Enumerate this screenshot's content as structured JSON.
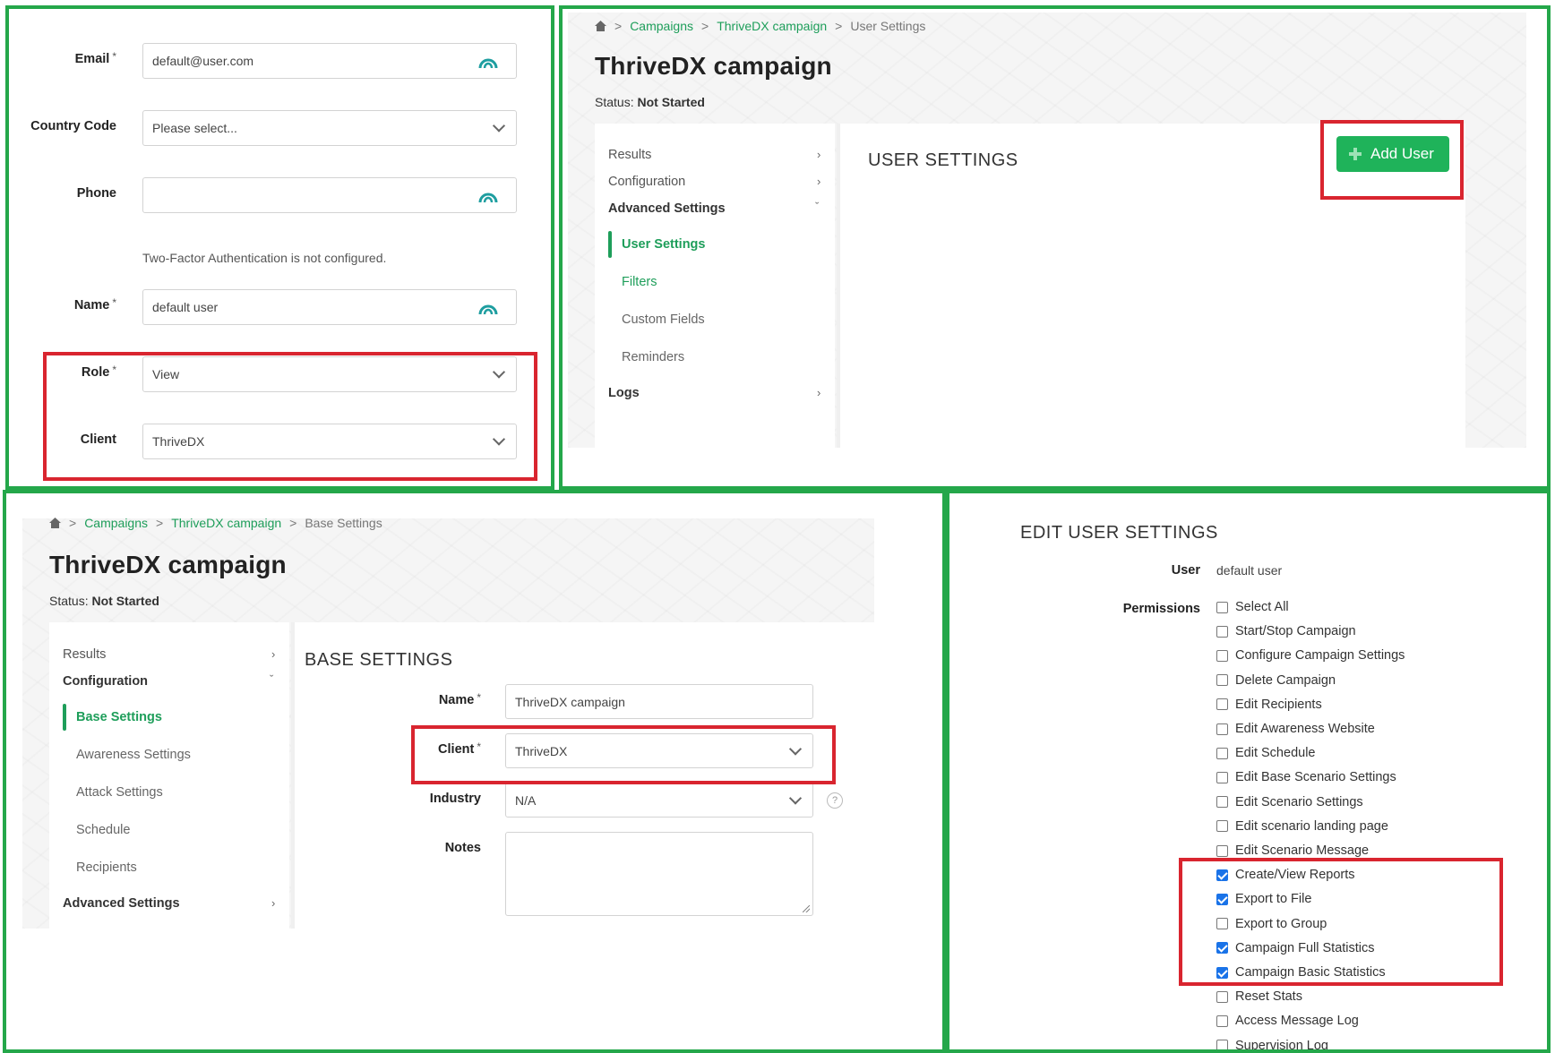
{
  "profile_form": {
    "email": {
      "label": "Email",
      "required": "*",
      "value": "default@user.com"
    },
    "country_code": {
      "label": "Country Code",
      "value": "Please select..."
    },
    "phone": {
      "label": "Phone",
      "value": ""
    },
    "two_factor_note": "Two-Factor Authentication is not configured.",
    "name": {
      "label": "Name",
      "required": "*",
      "value": "default user"
    },
    "role": {
      "label": "Role",
      "required": "*",
      "value": "View"
    },
    "client": {
      "label": "Client",
      "value": "ThriveDX"
    }
  },
  "user_settings_page": {
    "breadcrumb": [
      "Campaigns",
      "ThriveDX campaign",
      "User Settings"
    ],
    "title": "ThriveDX campaign",
    "status_label": "Status:",
    "status_value": "Not Started",
    "nav": {
      "results": "Results",
      "configuration": "Configuration",
      "advanced_settings": "Advanced Settings",
      "user_settings": "User Settings",
      "filters": "Filters",
      "custom_fields": "Custom Fields",
      "reminders": "Reminders",
      "logs": "Logs"
    },
    "section_title": "USER SETTINGS",
    "add_user_label": "Add User"
  },
  "base_settings_page": {
    "breadcrumb": [
      "Campaigns",
      "ThriveDX campaign",
      "Base Settings"
    ],
    "title": "ThriveDX campaign",
    "status_label": "Status:",
    "status_value": "Not Started",
    "nav": {
      "results": "Results",
      "configuration": "Configuration",
      "base_settings": "Base Settings",
      "awareness_settings": "Awareness Settings",
      "attack_settings": "Attack Settings",
      "schedule": "Schedule",
      "recipients": "Recipients",
      "advanced_settings": "Advanced Settings"
    },
    "section_title": "BASE SETTINGS",
    "name": {
      "label": "Name",
      "required": "*",
      "value": "ThriveDX campaign"
    },
    "client": {
      "label": "Client",
      "required": "*",
      "value": "ThriveDX"
    },
    "industry": {
      "label": "Industry",
      "value": "N/A"
    },
    "notes": {
      "label": "Notes",
      "value": ""
    },
    "help_glyph": "?"
  },
  "edit_user_settings": {
    "title": "EDIT USER SETTINGS",
    "user_label": "User",
    "user_value": "default user",
    "permissions_label": "Permissions",
    "permissions": [
      {
        "label": "Select All",
        "checked": false
      },
      {
        "label": "Start/Stop Campaign",
        "checked": false
      },
      {
        "label": "Configure Campaign Settings",
        "checked": false
      },
      {
        "label": "Delete Campaign",
        "checked": false
      },
      {
        "label": "Edit Recipients",
        "checked": false
      },
      {
        "label": "Edit Awareness Website",
        "checked": false
      },
      {
        "label": "Edit Schedule",
        "checked": false
      },
      {
        "label": "Edit Base Scenario Settings",
        "checked": false
      },
      {
        "label": "Edit Scenario Settings",
        "checked": false
      },
      {
        "label": "Edit scenario landing page",
        "checked": false
      },
      {
        "label": "Edit Scenario Message",
        "checked": false
      },
      {
        "label": "Create/View Reports",
        "checked": true
      },
      {
        "label": "Export to File",
        "checked": true
      },
      {
        "label": "Export to Group",
        "checked": false
      },
      {
        "label": "Campaign Full Statistics",
        "checked": true
      },
      {
        "label": "Campaign Basic Statistics",
        "checked": true
      },
      {
        "label": "Reset Stats",
        "checked": false
      },
      {
        "label": "Access Message Log",
        "checked": false
      },
      {
        "label": "Supervision Log",
        "checked": false
      }
    ]
  },
  "colors": {
    "panel_border": "#24a74a",
    "highlight_border": "#d9252f",
    "accent_green": "#1e9e5a",
    "button_green": "#1fb35a",
    "checkbox_blue": "#1a73e8"
  },
  "icons": {
    "field_assist": "lastpass-style-arc-icon",
    "home": "home-icon",
    "dropdown": "chevron-down-icon",
    "nav_expand": "chevron-right-icon",
    "add": "plus-icon",
    "help": "question-circle-icon"
  }
}
